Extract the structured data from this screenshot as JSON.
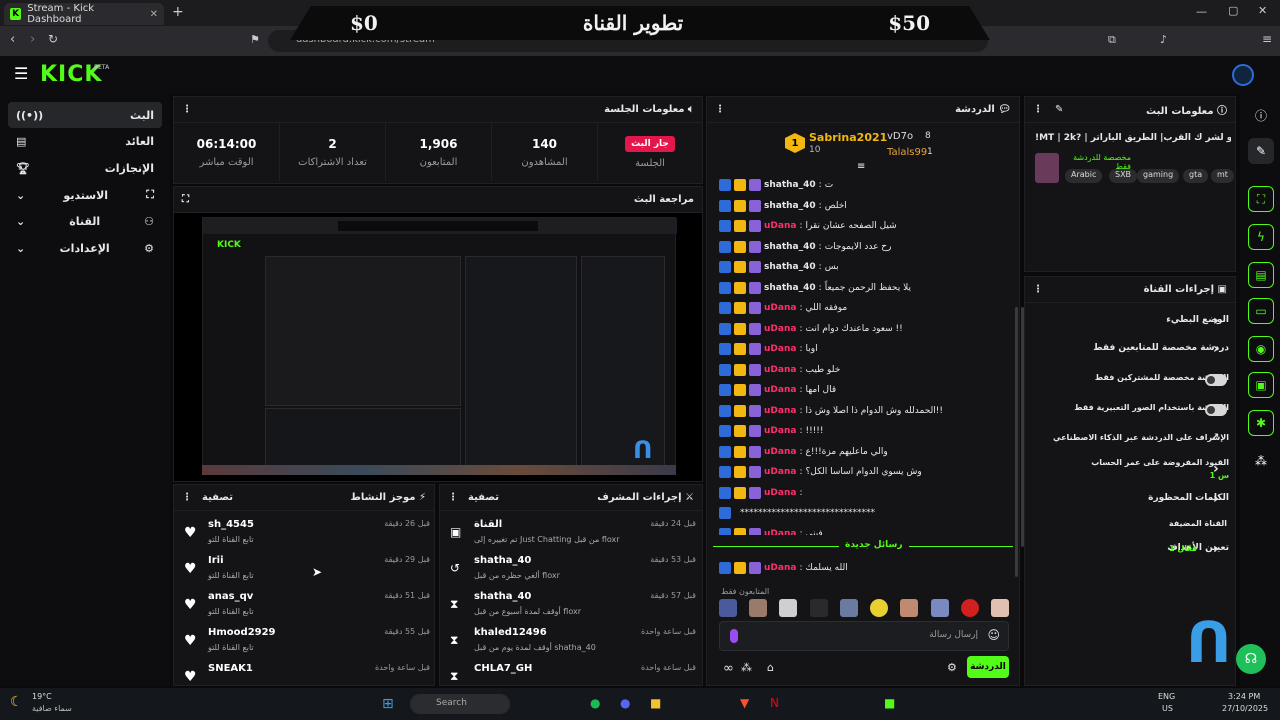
{
  "browser": {
    "tab_title": "Stream - Kick Dashboard",
    "url": "dashboard.kick.com/stream"
  },
  "overlay": {
    "left_amount": "$0",
    "title": "تطوير القناة",
    "right_amount": "$50"
  },
  "brand": {
    "logo": "KICK",
    "beta": "BETA"
  },
  "leftnav": [
    "البث",
    "العائد",
    "الإنجازات",
    "الاستديو",
    "القناة",
    "الإعدادات"
  ],
  "session": {
    "title": "معلومات الجلسة",
    "live_badge": "جار البث",
    "live_label": "الجلسة",
    "stats": [
      {
        "value": "140",
        "label": "المشاهدون"
      },
      {
        "value": "1,906",
        "label": "المتابعون"
      },
      {
        "value": "2",
        "label": "تعداد الاشتراكات"
      },
      {
        "value": "06:14:00",
        "label": "الوقت مباشر"
      }
    ]
  },
  "preview": {
    "title": "مراجعة البث"
  },
  "activity": {
    "title": "موجز النشاط",
    "filter": "تصفية",
    "items": [
      {
        "name": "sh_4545",
        "sub": "تابع القناة للتو",
        "time": "قبل 26 دقيقة"
      },
      {
        "name": "Irii",
        "sub": "تابع القناة للتو",
        "time": "قبل 29 دقيقة"
      },
      {
        "name": "anas_qv",
        "sub": "تابع القناة للتو",
        "time": "قبل 51 دقيقة"
      },
      {
        "name": "Hmood2929",
        "sub": "تابع القناة للتو",
        "time": "قبل 55 دقيقة"
      },
      {
        "name": "SNEAK1",
        "sub": "",
        "time": "قبل ساعة واحدة"
      }
    ]
  },
  "modactions": {
    "title": "إجراءات المشرف",
    "filter": "تصفية",
    "items": [
      {
        "name": "القناة",
        "sub": "تم تغييره إلى Just Chatting من قبل floxr",
        "time": "قبل 24 دقيقة",
        "icon": "channel-icon"
      },
      {
        "name": "shatha_40",
        "sub": "ألغي حظره من قبل floxr",
        "time": "قبل 53 دقيقة",
        "icon": "undo-icon"
      },
      {
        "name": "shatha_40",
        "sub": "أوقف لمدة أسبوع من قبل floxr",
        "time": "قبل 57 دقيقة",
        "icon": "timeout-icon"
      },
      {
        "name": "khaled12496",
        "sub": "أوقف لمدة يوم من قبل shatha_40",
        "time": "قبل ساعة واحدة",
        "icon": "timeout-icon"
      },
      {
        "name": "CHLA7_GH",
        "sub": "",
        "time": "قبل ساعة واحدة",
        "icon": "timeout-icon"
      }
    ]
  },
  "chat": {
    "title": "الدردشة",
    "top": [
      {
        "name": "Sabrina2021",
        "count": "10"
      },
      {
        "name": "vD7o",
        "count": "8"
      },
      {
        "name": "Talals99",
        "count": "1"
      }
    ],
    "messages": [
      {
        "user": "shatha_40",
        "text": "ت"
      },
      {
        "user": "shatha_40",
        "text": "اخلص"
      },
      {
        "user": "uDana",
        "text": "شيل الصفحه عشان نقرا"
      },
      {
        "user": "shatha_40",
        "text": "رح عدد الايموجات"
      },
      {
        "user": "shatha_40",
        "text": "بس"
      },
      {
        "user": "shatha_40",
        "text": "يلا يحفظ الرحمن جميعاً"
      },
      {
        "user": "uDana",
        "text": "موفقه اللي"
      },
      {
        "user": "uDana",
        "text": "سعود ماعندك دوام انت !!"
      },
      {
        "user": "uDana",
        "text": "اوبا"
      },
      {
        "user": "uDana",
        "text": "خلو طيب"
      },
      {
        "user": "uDana",
        "text": "قال امها"
      },
      {
        "user": "uDana",
        "text": "الحمدلله وش الدوام ذا اصلا وش ذا!!"
      },
      {
        "user": "uDana",
        "text": "!!!!!"
      },
      {
        "user": "uDana",
        "text": "والي ماعليهم مزة!!!ع"
      },
      {
        "user": "uDana",
        "text": "وش يسوي الدوام اساسا الكل؟"
      },
      {
        "user": "uDana",
        "text": ""
      },
      {
        "user": "",
        "text": "******************************"
      },
      {
        "user": "uDana",
        "text": "فيني"
      }
    ],
    "divider": "رسائل جديدة",
    "last": {
      "user": "uDana",
      "text": "الله يسلمك"
    },
    "followers_only": "المتابعون فقط",
    "input_placeholder": "إرسال رسالة",
    "send_button": "الدردشة"
  },
  "streaminfo": {
    "title": "معلومات البث",
    "stream_title": "!MT | 2k? | استحو لشر ك القرب| الطريق الباراتر",
    "subtitle": "مخصصة للدردشة فقط",
    "tags": [
      "Arabic",
      "SXB",
      "gaming",
      "gta",
      "mt"
    ]
  },
  "channelactions": {
    "title": "إجراءات القناة",
    "items": [
      {
        "label": "الوضع البطيء",
        "kind": "chevron"
      },
      {
        "label": "دردشة مخصصة للمتابعين فقط",
        "kind": "chevron"
      },
      {
        "label": "الدردشة مخصصة للمشتركين فقط",
        "kind": "toggle"
      },
      {
        "label": "الدردشة باستخدام الصور التعبيرية فقط",
        "kind": "toggle"
      },
      {
        "label": "الإشراف على الدردشة عبر الذكاء الاصطناعي",
        "kind": "external"
      },
      {
        "label": "القيود المفروضة على عمر الحساب",
        "kind": "chevron",
        "extra": "1 س"
      },
      {
        "label": "الكلمات المحظورة",
        "kind": "chevron"
      }
    ],
    "section": "القناة المضيفة",
    "goals_label": "تعيين الأهداف",
    "goals_status": "1 فعّال"
  },
  "taskbar": {
    "weather_temp": "19°C",
    "weather_desc": "سماء صافية",
    "search": "Search",
    "lang1": "ENG",
    "lang2": "US",
    "time": "3:24 PM",
    "date": "27/10/2025"
  }
}
